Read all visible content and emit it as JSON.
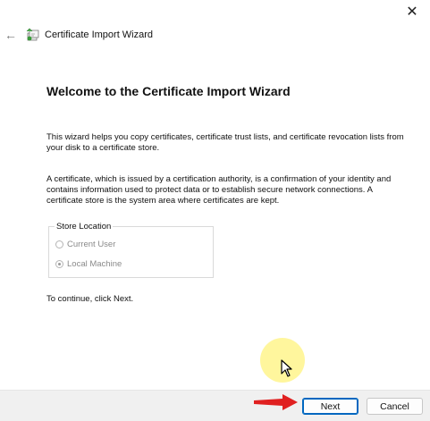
{
  "window": {
    "title": "Certificate Import Wizard"
  },
  "content": {
    "heading": "Welcome to the Certificate Import Wizard",
    "paragraph1": "This wizard helps you copy certificates, certificate trust lists, and certificate revocation lists from your disk to a certificate store.",
    "paragraph2": "A certificate, which is issued by a certification authority, is a confirmation of your identity and contains information used to protect data or to establish secure network connections. A certificate store is the system area where certificates are kept.",
    "store_location": {
      "label": "Store Location",
      "options": [
        {
          "label": "Current User",
          "selected": false,
          "disabled": true
        },
        {
          "label": "Local Machine",
          "selected": true,
          "disabled": true
        }
      ]
    },
    "continue_text": "To continue, click Next."
  },
  "buttons": {
    "next": "Next",
    "cancel": "Cancel"
  },
  "icons": {
    "close": "close-icon",
    "back": "back-arrow-icon",
    "wizard": "certificate-wizard-icon"
  },
  "colors": {
    "accent": "#0067c0",
    "annotation_arrow": "#e02020",
    "cursor_highlight": "#fff58c"
  }
}
